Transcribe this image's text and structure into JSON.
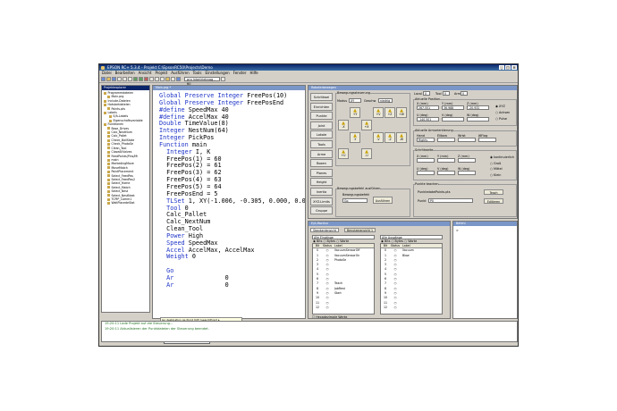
{
  "window": {
    "title": "EPSON RC+ 5.3.4 - Projekt C:\\EpsonRC50\\Projects\\Demo"
  },
  "menu": [
    "Datei",
    "Bearbeiten",
    "Ansicht",
    "Projekt",
    "Ausführen",
    "Tools",
    "Einstellungen",
    "Fenster",
    "Hilfe"
  ],
  "toolbar": {
    "speed_value": "pro Inbetriebnag - 60"
  },
  "explorer": {
    "title": "Projektexplorer",
    "items": [
      "Programmdateien",
      "Main.prg",
      "Include-Dateien",
      "Hotstartdateien",
      "Points.pts",
      "Labels",
      "E/A-Labels",
      "Eigenschaftsvariable",
      "Funktionen",
      "Base_Drives",
      "Calc_NextNum",
      "Calc_Pallet",
      "Check_BallState",
      "Check_PhotoSe",
      "Clean_Tool",
      "CloseAllValves",
      "FeedPoints(Pins/Mi",
      "main",
      "MarkedingMove",
      "MoveMatch",
      "PointPlacement",
      "Select_FeedPos",
      "Select_FeedPos2",
      "Select_Home",
      "Select_Match",
      "Select_Nest",
      "Select_NestNext",
      "TCPIP_Comm1",
      "WaitPlacedeStat"
    ]
  },
  "editor": {
    "title": "Main.prg *",
    "lines": [
      {
        "kw": "Global Preserve Integer",
        "rest": " FreePos(10)"
      },
      {
        "kw": "Global Preserve Integer",
        "rest": " FreePosEnd"
      },
      {
        "kw": "",
        "rest": ""
      },
      {
        "kw": "#define",
        "rest": " SpeedMax 40"
      },
      {
        "kw": "#define",
        "rest": " AccelMax 40"
      },
      {
        "kw": "",
        "rest": ""
      },
      {
        "kw": "",
        "rest": ""
      },
      {
        "kw": "Double",
        "rest": " TimeValue(8)"
      },
      {
        "kw": "Integer",
        "rest": " NestNum(64)"
      },
      {
        "kw": "Integer",
        "rest": " PickPos"
      },
      {
        "kw": "",
        "rest": ""
      },
      {
        "kw": "Function",
        "rest": " main"
      },
      {
        "kw": "  Integer",
        "rest": " I, K"
      },
      {
        "kw": "",
        "rest": "  FreePos(1) = 60"
      },
      {
        "kw": "",
        "rest": "  FreePos(2) = 61"
      },
      {
        "kw": "",
        "rest": "  FreePos(3) = 62"
      },
      {
        "kw": "",
        "rest": "  FreePos(4) = 63"
      },
      {
        "kw": "",
        "rest": "  FreePos(5) = 64"
      },
      {
        "kw": "",
        "rest": "  FreePosEnd = 5"
      },
      {
        "kw": "  TLSet",
        "rest": " 1, XY(-1.006, -0.305, 0.000, 0.000"
      },
      {
        "kw": "  Tool",
        "rest": " 0"
      },
      {
        "kw": "",
        "rest": "  Calc_Pallet"
      },
      {
        "kw": "",
        "rest": "  Calc_NextNum"
      },
      {
        "kw": "",
        "rest": "  Clean_Tool"
      },
      {
        "kw": "  Power",
        "rest": " High"
      },
      {
        "kw": "  Speed",
        "rest": " SpeedMax"
      },
      {
        "kw": "  Accel",
        "rest": " AccelMax, AccelMax"
      },
      {
        "kw": "  Weight",
        "rest": " 0"
      }
    ],
    "tail": [
      {
        "kw": "  Go",
        "rest": ""
      },
      {
        "kw": "  Ar",
        "rest": "              0"
      },
      {
        "kw": "  Ar",
        "rest": "              0"
      }
    ],
    "tooltip": "Go destination As Point [CP] [searchExpr] ▸",
    "autocomplete": [
      "Pallet_Angle",
      "Pallet_Plane",
      "Pallet_Umgrong",
      "Test#"
    ]
  },
  "jog": {
    "title": "Roboterbewegen",
    "side_buttons": [
      "Schrittwei",
      "Einrichten",
      "Punkte",
      "Joint",
      "Lokale",
      "Tools",
      "Arme",
      "Boxen",
      "Planes",
      "Height",
      "Inertia",
      "XYZ-Limits",
      "Gruppe"
    ],
    "jog_group": "Bewegungssteuerung",
    "mode_label": "Modus",
    "mode_value": "XY",
    "speed_label": "Geschw",
    "speed_value": "niedrig",
    "jog_buttons": [
      {
        "t": "+Y"
      },
      {
        "t": "-X"
      },
      {
        "t": "+X"
      },
      {
        "t": "-Y"
      },
      {
        "t": "+Z"
      },
      {
        "t": "-Z"
      },
      {
        "t": "+U"
      },
      {
        "t": "-U"
      },
      {
        "t": "+V"
      },
      {
        "t": "-V"
      },
      {
        "t": "+W"
      },
      {
        "t": "-W"
      }
    ],
    "local_label": "Local",
    "local_value": "0",
    "tool_label": "Tool",
    "tool_value": "0",
    "arm_label": "Arm",
    "arm_value": "0",
    "pos_group": "Aktuelle Position",
    "pos_headers": [
      "X (mm)",
      "Y (mm)",
      "Z (mm)"
    ],
    "pos_values": [
      "267.551",
      "36.988",
      "-20.932"
    ],
    "pos_headers2": [
      "U (deg)",
      "V (deg)",
      "W (deg)"
    ],
    "pos_values2": [
      "-140.501",
      "",
      ""
    ],
    "radio_world": "XYZ",
    "radio_joint": "Achsen",
    "radio_pulse": "Pulse",
    "arm_group": "Aktuelle Armorientierung",
    "arm_headers": [
      "Hand",
      "Ellbow",
      "Wrist",
      "J6Flag"
    ],
    "arm_values": [
      "Righty",
      "",
      "",
      ""
    ],
    "step_group": "Schrittweite",
    "step_headers": [
      "X (mm)",
      "Y (mm)",
      "Z (mm)"
    ],
    "step_row1": [
      "",
      "",
      ""
    ],
    "step_headers2": [
      "U (deg)",
      "V (deg)",
      "W (deg)"
    ],
    "step_row2": [
      "",
      "",
      ""
    ],
    "step_options": [
      "kontinuierlich",
      "Groß",
      "Mittel",
      "Klein"
    ],
    "exec_group": "Bewegungsbefehl ausführen",
    "exec_label": "Bewegungsbefehl",
    "exec_value": "Go",
    "exec_button": "Ausführen",
    "teach_group": "Punkte teachen",
    "teach_file_label": "Punktedatei",
    "teach_file_value": "Points.pts",
    "teach_button": "Teach",
    "teach_point_label": "Punkt",
    "teach_point_value": "P0",
    "teach_button2": "Editieren"
  },
  "io": {
    "title": "E/A-Monitor",
    "tabs": [
      "Standardansicht",
      "Benutzeransicht 1"
    ],
    "inputs_title": "Alle Eingänge",
    "outputs_title": "Alle Ausgänge",
    "radio": [
      "Bits",
      "Bytes",
      "Worte"
    ],
    "headers": [
      "Bit",
      "Status",
      "Label"
    ],
    "inputs": [
      {
        "b": "0",
        "l": "VacuumSensorOff"
      },
      {
        "b": "1",
        "l": "VacuumSensorOn"
      },
      {
        "b": "2",
        "l": "PhotoSe"
      },
      {
        "b": "3",
        "l": ""
      },
      {
        "b": "4",
        "l": ""
      },
      {
        "b": "5",
        "l": ""
      },
      {
        "b": "6",
        "l": ""
      },
      {
        "b": "7",
        "l": "Teach"
      },
      {
        "b": "8",
        "l": "JobRest"
      },
      {
        "b": "9",
        "l": "Start"
      },
      {
        "b": "10",
        "l": ""
      },
      {
        "b": "11",
        "l": ""
      },
      {
        "b": "12",
        "l": ""
      }
    ],
    "outputs": [
      {
        "b": "0",
        "l": "Vacuum"
      },
      {
        "b": "1",
        "l": "Blow"
      },
      {
        "b": "2",
        "l": ""
      },
      {
        "b": "3",
        "l": ""
      },
      {
        "b": "4",
        "l": ""
      },
      {
        "b": "5",
        "l": ""
      },
      {
        "b": "6",
        "l": ""
      },
      {
        "b": "7",
        "l": ""
      },
      {
        "b": "8",
        "l": ""
      },
      {
        "b": "9",
        "l": ""
      },
      {
        "b": "10",
        "l": ""
      },
      {
        "b": "11",
        "l": ""
      },
      {
        "b": "12",
        "l": ""
      }
    ],
    "hex_label": "Hexadezimale Werte"
  },
  "terminal": {
    "title": "Befehl",
    "prompt": ">"
  },
  "output": {
    "lines": [
      "19:20:11 Lade Projekt auf die Steuerung...",
      "19:20:11 Aktualisieren der Punktdateien der Steuerung beendet."
    ]
  }
}
